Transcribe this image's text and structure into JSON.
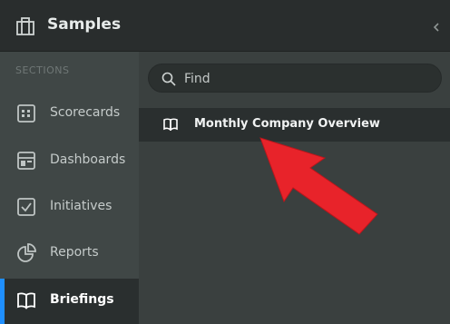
{
  "header": {
    "title": "Samples",
    "icon": "briefcase-icon",
    "collapse_icon": "chevron-left-icon"
  },
  "sidebar": {
    "section_title": "SECTIONS",
    "items": [
      {
        "label": "Scorecards",
        "icon": "scorecard-icon",
        "active": false
      },
      {
        "label": "Dashboards",
        "icon": "dashboard-icon",
        "active": false
      },
      {
        "label": "Initiatives",
        "icon": "checkbox-icon",
        "active": false
      },
      {
        "label": "Reports",
        "icon": "pie-chart-icon",
        "active": false
      },
      {
        "label": "Briefings",
        "icon": "book-icon",
        "active": true
      }
    ]
  },
  "content": {
    "search": {
      "placeholder": "Find",
      "value": ""
    },
    "briefings": [
      {
        "label": "Monthly Company Overview",
        "icon": "book-icon"
      }
    ]
  },
  "colors": {
    "accent": "#1f8fff",
    "annotation_arrow": "#e8232a",
    "header_bg": "#292d2d",
    "sidebar_bg": "#404746",
    "content_bg": "#3a403f"
  }
}
